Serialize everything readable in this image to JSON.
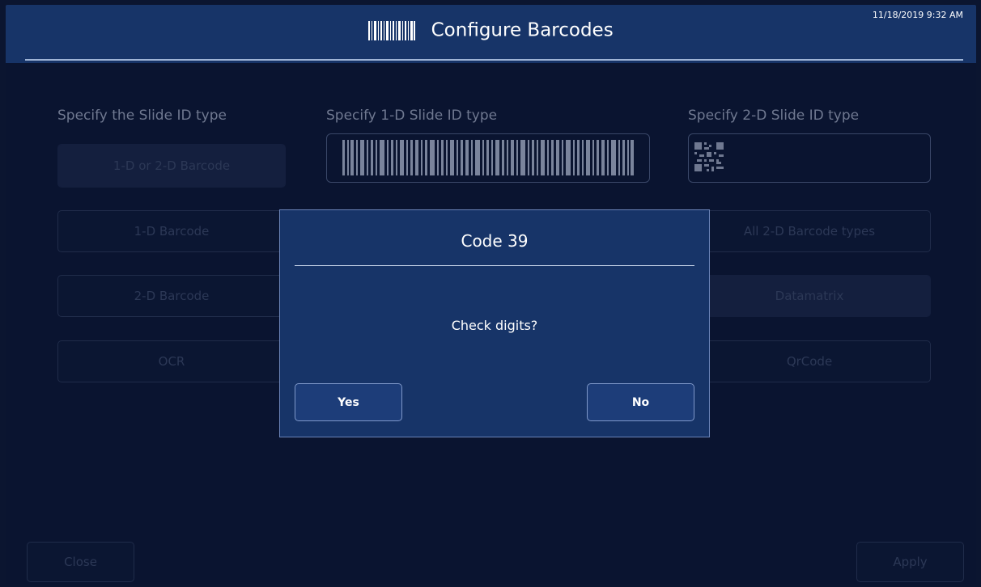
{
  "header": {
    "title": "Configure Barcodes",
    "icon": "barcode-icon",
    "datetime": "11/18/2019 9:32 AM"
  },
  "columns": {
    "slide_id_type_title": "Specify the Slide ID type",
    "one_d_title": "Specify 1-D Slide ID type",
    "two_d_title": "Specify 2-D Slide ID type"
  },
  "slide_id_options": [
    "1-D or 2-D Barcode",
    "1-D Barcode",
    "2-D Barcode",
    "OCR"
  ],
  "two_d_options": [
    "All 2-D Barcode types",
    "Datamatrix",
    "QrCode"
  ],
  "footer": {
    "close_label": "Close",
    "apply_label": "Apply"
  },
  "dialog": {
    "title": "Code 39",
    "message": "Check digits?",
    "yes_label": "Yes",
    "no_label": "No"
  },
  "colors": {
    "header_bg": "#173468",
    "page_bg": "#0a1430",
    "dialog_bg": "#173468"
  }
}
